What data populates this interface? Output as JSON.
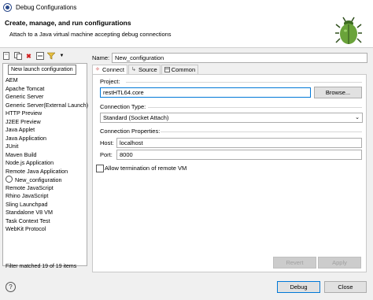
{
  "window": {
    "title": "Debug Configurations"
  },
  "header": {
    "title": "Create, manage, and run configurations",
    "description": "Attach to a Java virtual machine accepting debug connections"
  },
  "toolbar": {
    "tooltip": "New launch configuration"
  },
  "tree": {
    "items": [
      "AEM",
      "Apache Tomcat",
      "Generic Server",
      "Generic Server(External Launch)",
      "HTTP Preview",
      "J2EE Preview",
      "Java Applet",
      "Java Application",
      "JUnit",
      "Maven Build",
      "Node.js Application",
      "Remote Java Application",
      "New_configuration",
      "Remote JavaScript",
      "Rhino JavaScript",
      "Sling Launchpad",
      "Standalone V8 VM",
      "Task Context Test",
      "WebKit Protocol"
    ],
    "filter_status": "Filter matched 19 of 19 items"
  },
  "form": {
    "name_label": "Name:",
    "name_value": "New_configuration",
    "tabs": [
      "Connect",
      "Source",
      "Common"
    ],
    "project_label": "Project:",
    "project_value": "restHTL64.core",
    "browse_label": "Browse...",
    "connection_type_label": "Connection Type:",
    "connection_type_value": "Standard (Socket Attach)",
    "connection_props_label": "Connection Properties:",
    "host_label": "Host:",
    "host_value": "localhost",
    "port_label": "Port:",
    "port_value": "8000",
    "allow_termination_label": "Allow termination of remote VM",
    "revert_label": "Revert",
    "apply_label": "Apply"
  },
  "footer": {
    "debug_label": "Debug",
    "close_label": "Close"
  }
}
